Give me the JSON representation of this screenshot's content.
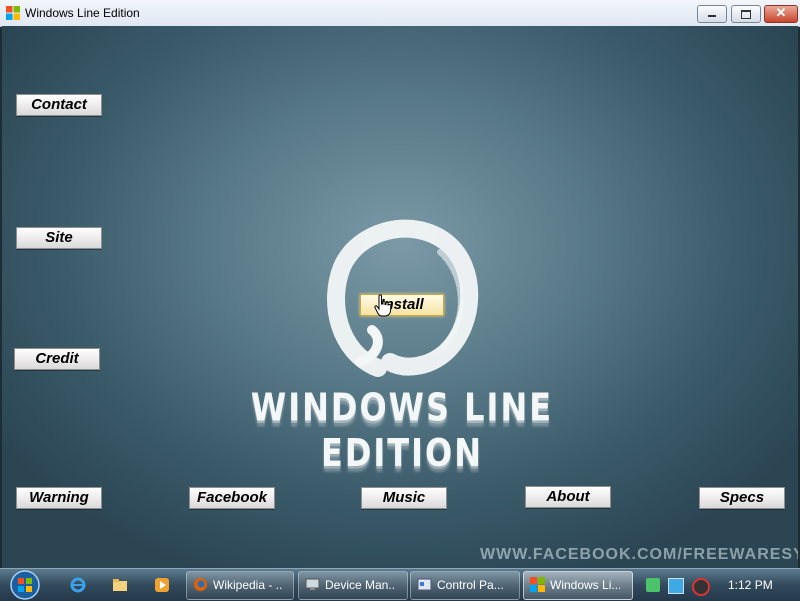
{
  "window": {
    "title": "Windows Line Edition"
  },
  "buttons": {
    "contact": "Contact",
    "site": "Site",
    "credit": "Credit",
    "install": "Install",
    "warning": "Warning",
    "facebook": "Facebook",
    "music": "Music",
    "about": "About",
    "specs": "Specs"
  },
  "logo": {
    "text": "WINDOWS LINE EDITION"
  },
  "watermark": "WWW.FACEBOOK.COM/FREEWARESYS",
  "taskbar": {
    "quick_launch": [
      "internet-explorer-icon",
      "explorer-folder-icon",
      "media-player-icon"
    ],
    "tasks": [
      {
        "label": "Wikipedia - ...",
        "icon": "firefox-icon"
      },
      {
        "label": "Device Man...",
        "icon": "device-manager-icon"
      },
      {
        "label": "Control Pa...",
        "icon": "control-panel-icon"
      },
      {
        "label": "Windows Li...",
        "icon": "windows-line-icon"
      }
    ],
    "clock": "1:12 PM"
  },
  "colors": {
    "background": "#587987",
    "install_glow": "#f6d46b",
    "taskbar": "#324a5c"
  }
}
